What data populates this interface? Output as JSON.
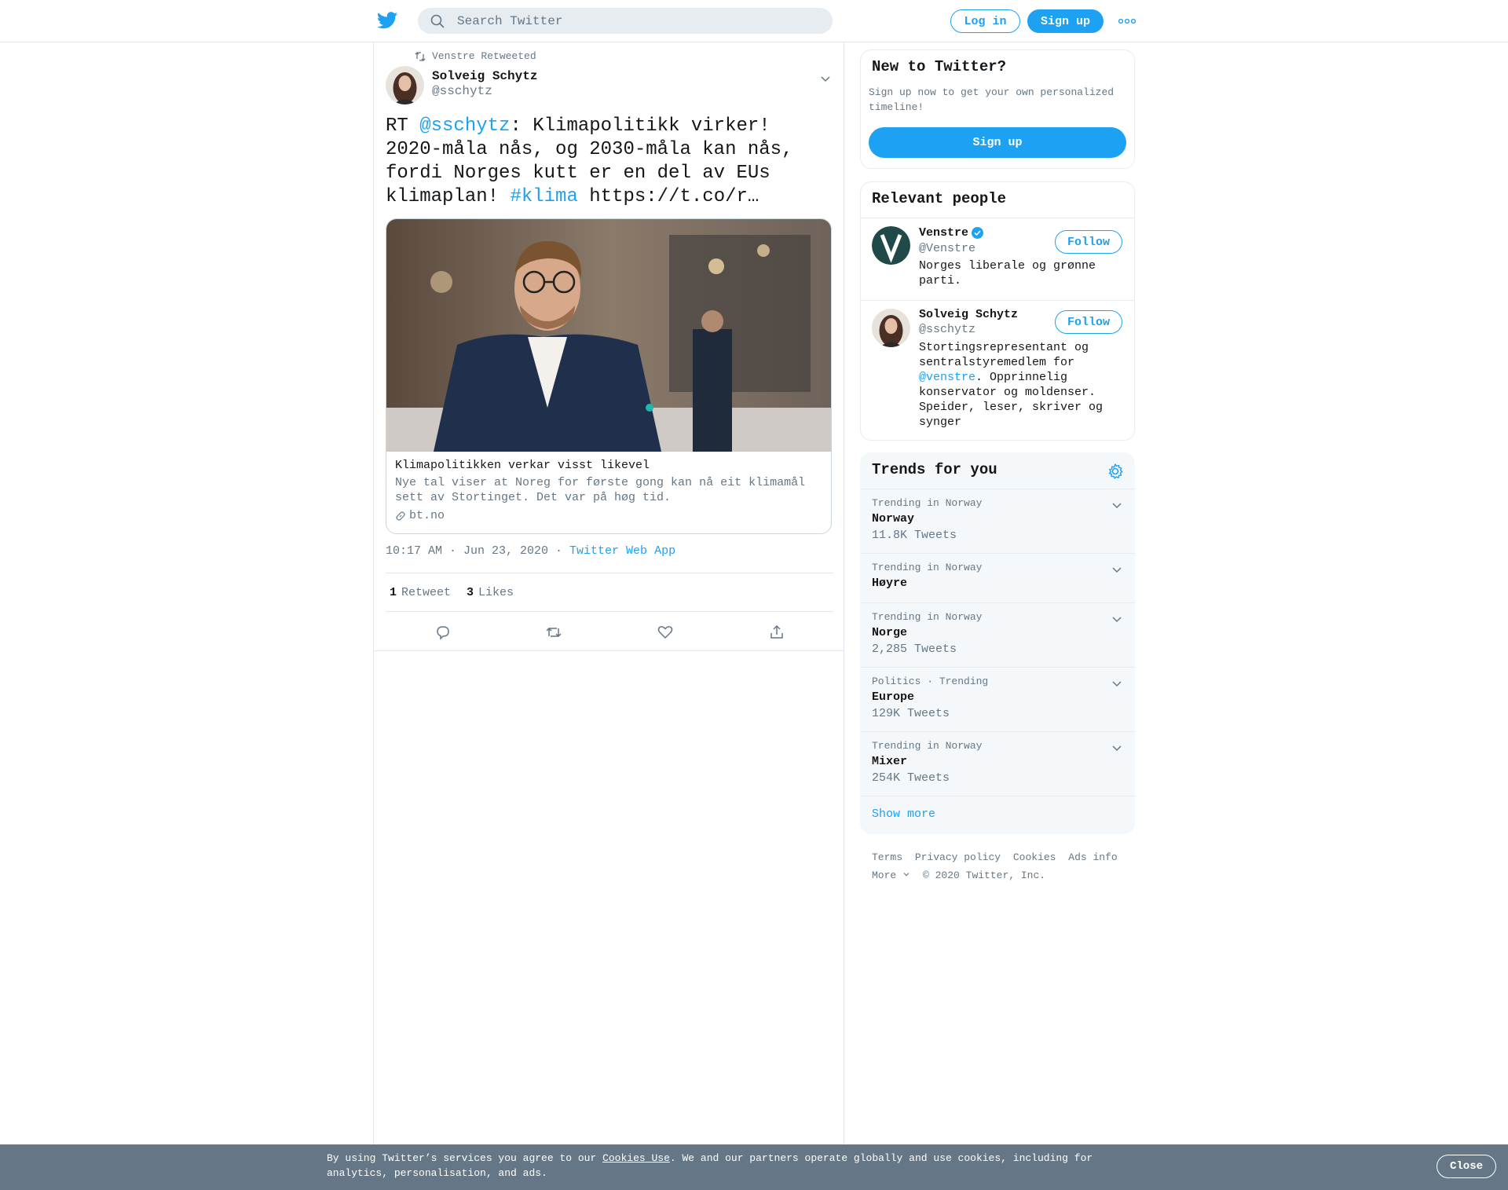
{
  "header": {
    "search_placeholder": "Search Twitter",
    "login_label": "Log in",
    "signup_label": "Sign up"
  },
  "tweet": {
    "retweeted_by": "Venstre Retweeted",
    "author_name": "Solveig Schytz",
    "author_handle": "@sschytz",
    "text_prefix": "RT ",
    "text_mention": "@sschytz",
    "text_body": ": Klimapolitikk virker! 2020-måla nås, og 2030-måla kan nås, fordi Norges kutt er en del av EUs klimaplan! ",
    "text_hashtag": "#klima",
    "text_link": " https://t.co/r…",
    "card": {
      "title": "Klimapolitikken verkar visst likevel",
      "description": "Nye tal viser at Noreg for første gong kan nå eit klimamål sett av Stortinget. Det var på høg tid.",
      "domain": "bt.no"
    },
    "timestamp": "10:17 AM · Jun 23, 2020 · ",
    "source": "Twitter Web App",
    "retweet_count": "1",
    "retweet_label": "Retweet",
    "like_count": "3",
    "like_label": "Likes"
  },
  "sidebar": {
    "signup_box": {
      "title": "New to Twitter?",
      "description": "Sign up now to get your own personalized timeline!",
      "button": "Sign up"
    },
    "relevant_people": {
      "title": "Relevant people",
      "people": [
        {
          "name": "Venstre",
          "handle": "@Venstre",
          "bio": "Norges liberale og grønne parti.",
          "follow": "Follow"
        },
        {
          "name": "Solveig Schytz",
          "handle": "@sschytz",
          "bio_before": "Stortingsrepresentant og sentralstyremedlem for ",
          "bio_mention": "@venstre",
          "bio_after": ". Opprinnelig konservator og moldenser. Speider, leser, skriver og synger",
          "follow": "Follow"
        }
      ]
    },
    "trends": {
      "title": "Trends for you",
      "items": [
        {
          "context": "Trending in Norway",
          "name": "Norway",
          "count": "11.8K Tweets"
        },
        {
          "context": "Trending in Norway",
          "name": "Høyre",
          "count": ""
        },
        {
          "context": "Trending in Norway",
          "name": "Norge",
          "count": "2,285 Tweets"
        },
        {
          "context": "Politics · Trending",
          "name": "Europe",
          "count": "129K Tweets"
        },
        {
          "context": "Trending in Norway",
          "name": "Mixer",
          "count": "254K Tweets"
        }
      ],
      "show_more": "Show more"
    },
    "footer": {
      "terms": "Terms",
      "privacy": "Privacy policy",
      "cookies": "Cookies",
      "ads": "Ads info",
      "more": "More",
      "copyright": "© 2020 Twitter, Inc."
    }
  },
  "cookie_bar": {
    "text_before": "By using Twitter’s services you agree to our ",
    "link": "Cookies Use",
    "text_after": ". We and our partners operate globally and use cookies, including for analytics, personalisation, and ads.",
    "close": "Close"
  },
  "colors": {
    "accent": "#1da1f2",
    "muted": "#657786",
    "cookie_bar": "#657786"
  }
}
